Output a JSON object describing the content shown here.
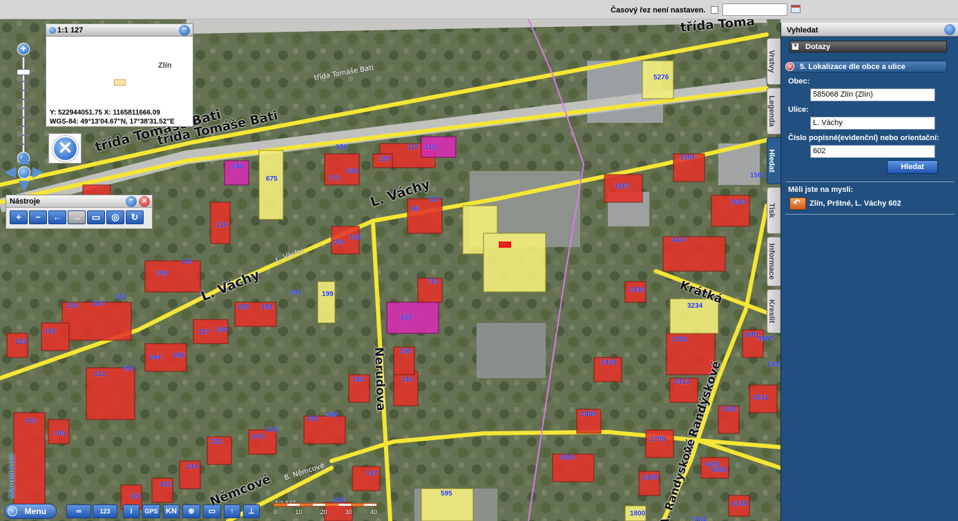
{
  "topbar": {
    "time_slice_label": "Časový řez není nastaven.",
    "date_value": ""
  },
  "overview": {
    "scale": "1:1 127",
    "city": "Zlín",
    "coords_line1": "Y: 522944051.75 X: 1165811666.09",
    "coords_line2": "WGS-84: 49°13'04.67\"N, 17°38'31.52\"E"
  },
  "tools": {
    "title": "Nástroje",
    "buttons": [
      "+",
      "−",
      "←",
      "→",
      "▭",
      "◎",
      "↻"
    ]
  },
  "streets": [
    {
      "label": "třída Tomáše Bati"
    },
    {
      "label": "třída Tomáše Bati"
    },
    {
      "label": "třída Tomáše Bati"
    },
    {
      "label": "třída Tomá"
    },
    {
      "label": "L. Váchy"
    },
    {
      "label": "L. Váchy"
    },
    {
      "label": "L. Váchy"
    },
    {
      "label": "Nerudova"
    },
    {
      "label": "Krátká"
    },
    {
      "label": "A. Randýskové"
    },
    {
      "label": "A. Randýskové"
    },
    {
      "label": "B. Němcové"
    },
    {
      "label": "Němcové"
    }
  ],
  "building_numbers": [
    "136",
    "112",
    "111",
    "128",
    "146",
    "675",
    "171",
    "624",
    "137",
    "96",
    "115",
    "159",
    "160",
    "602",
    "110",
    "109",
    "591",
    "199",
    "715",
    "118",
    "163",
    "142",
    "205",
    "189",
    "167",
    "133",
    "124",
    "127",
    "196",
    "158",
    "244",
    "198",
    "113",
    "353",
    "180",
    "144",
    "173",
    "149",
    "222",
    "379",
    "378",
    "601",
    "368",
    "214",
    "432",
    "147",
    "221",
    "256",
    "595",
    "5276",
    "1584",
    "1567",
    "1582",
    "2663",
    "4447",
    "2436",
    "3234",
    "1798",
    "1681",
    "5997",
    "1930",
    "2428",
    "2413",
    "1631",
    "1692",
    "2409",
    "1799",
    "4255",
    "2408",
    "1603",
    "6006",
    "6138",
    "1800",
    "1704",
    "1704",
    "1600",
    "1604",
    "1704"
  ],
  "bottom_toolbar": {
    "menu": "Menu",
    "buttons": [
      "123",
      "i",
      "GPS",
      "KN",
      "⊕",
      "▭",
      "↑",
      "⊥"
    ]
  },
  "scalebar": {
    "label": "1:1 127",
    "ticks": [
      "0",
      "10",
      "20",
      "30",
      "40"
    ]
  },
  "watermark": "Marushka©",
  "panel": {
    "title": "Vyhledat",
    "tabs": [
      "Vrstvy",
      "Legenda",
      "Hledat",
      "Tisk",
      "Informace",
      "Kreslit"
    ],
    "active_tab": "Hledat",
    "section_dotazy": "Dotazy",
    "section_lokalizace": "5. Lokalizace dle obce a ulice",
    "obec_label": "Obec:",
    "obec_value": "585068 Zlín (Zlín)",
    "ulice_label": "Ulice:",
    "ulice_value": "L. Váchy",
    "cislo_label": "Číslo popisné(evidenční) nebo orientační:",
    "cislo_value": "602",
    "search_button": "Hledat",
    "suggest_label": "Měli jste na mysli:",
    "suggest_result": "Zlín, Prštné, L. Váchy 602"
  },
  "colors": {
    "road": "#f5e635",
    "building_red": "#e5332a",
    "building_magenta": "#d42fb0",
    "building_yellow": "#f2ee7a",
    "panel_bg": "#214f7f",
    "number_blue": "#2433e6"
  }
}
